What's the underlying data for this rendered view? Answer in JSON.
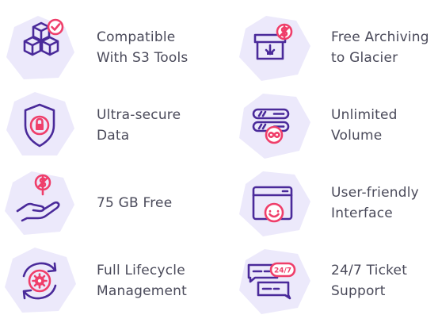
{
  "features": [
    {
      "line1": "Compatible",
      "line2": "With S3 Tools",
      "icon": "cubes-check-icon"
    },
    {
      "line1": "Free Archiving",
      "line2": "to Glacier",
      "icon": "archive-dollar-icon"
    },
    {
      "line1": "Ultra-secure",
      "line2": "Data",
      "icon": "shield-lock-icon"
    },
    {
      "line1": "Unlimited",
      "line2": "Volume",
      "icon": "server-infinity-icon"
    },
    {
      "line1": "75 GB Free",
      "line2": "",
      "icon": "hand-coin-icon"
    },
    {
      "line1": "User-friendly",
      "line2": "Interface",
      "icon": "window-smile-icon"
    },
    {
      "line1": "Full Lifecycle",
      "line2": "Management",
      "icon": "cycle-gear-icon"
    },
    {
      "line1": "24/7 Ticket",
      "line2": "Support",
      "icon": "chat-247-icon"
    }
  ],
  "badge_247": "24/7",
  "colors": {
    "text": "#4a4a5a",
    "icon_line": "#4a2a9a",
    "icon_accent": "#ef3e6a",
    "icon_background": "#ece9fb"
  }
}
